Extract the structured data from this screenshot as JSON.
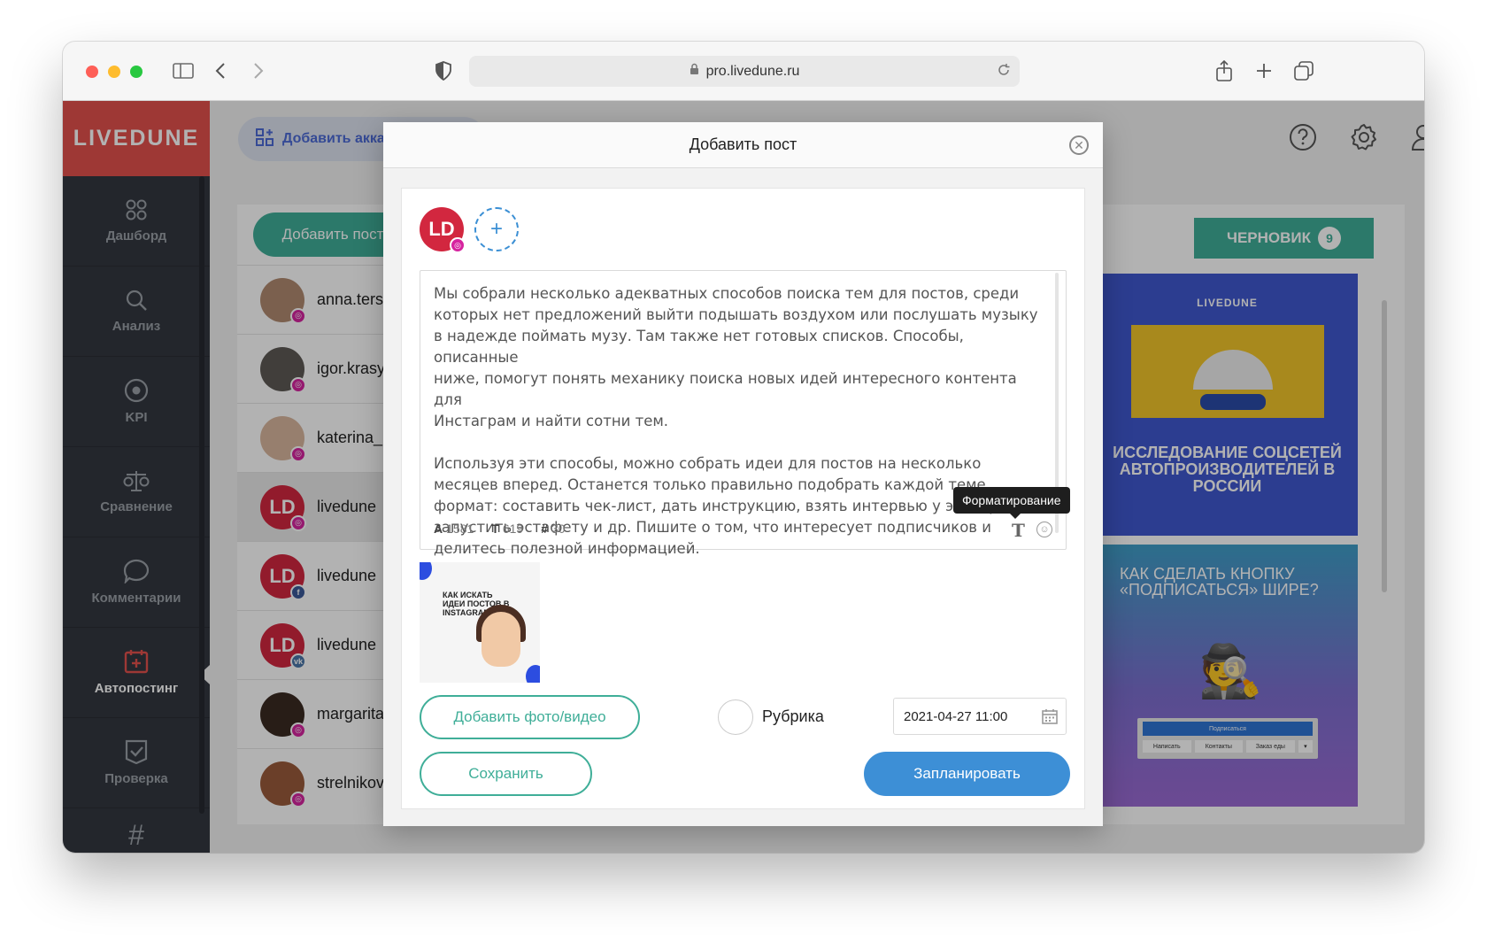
{
  "browser": {
    "url": "pro.livedune.ru"
  },
  "app": {
    "logo": "LIVEDUNE",
    "add_account_label": "Добавить акка"
  },
  "sidebar": {
    "items": [
      {
        "label": "Дашборд",
        "icon": "dashboard-icon"
      },
      {
        "label": "Анализ",
        "icon": "search-icon"
      },
      {
        "label": "KPI",
        "icon": "target-icon"
      },
      {
        "label": "Сравнение",
        "icon": "scales-icon"
      },
      {
        "label": "Комментарии",
        "icon": "comment-icon"
      },
      {
        "label": "Автопостинг",
        "icon": "calendar-plus-icon",
        "active": true
      },
      {
        "label": "Проверка",
        "icon": "check-shield-icon"
      },
      {
        "label": "#",
        "icon": "hashtag-icon"
      }
    ]
  },
  "left_panel": {
    "add_post_label": "Добавить пост",
    "accounts": [
      {
        "name": "anna.ters",
        "network": "instagram"
      },
      {
        "name": "igor.krasy",
        "network": "instagram"
      },
      {
        "name": "katerina_",
        "network": "instagram"
      },
      {
        "name": "livedune",
        "network": "instagram",
        "initials": "LD"
      },
      {
        "name": "livedune",
        "network": "facebook",
        "initials": "LD"
      },
      {
        "name": "livedune",
        "network": "vk",
        "initials": "LD"
      },
      {
        "name": "margarita",
        "network": "instagram"
      },
      {
        "name": "strelnikov",
        "network": "instagram"
      }
    ]
  },
  "right_panel": {
    "draft_label": "ЧЕРНОВИК",
    "draft_count": "9",
    "card1": {
      "brand": "LIVEDUNE",
      "headline": "ИССЛЕДОВАНИЕ СОЦСЕТЕЙ АВТОПРОИЗВОДИТЕЛЕЙ В РОССИИ"
    },
    "card2": {
      "headline": "КАК СДЕЛАТЬ КНОПКУ «ПОДПИСАТЬСЯ» ШИРЕ?",
      "mock_button": "Подписаться",
      "mock_tabs": [
        "Написать",
        "Контакты",
        "Заказ еды",
        "▾"
      ]
    }
  },
  "modal": {
    "title": "Добавить пост",
    "avatar_initials": "LD",
    "post_text": "Мы собрали несколько адекватных способов поиска тем для постов, среди\nкоторых нет предложений выйти подышать воздухом или послушать музыку\nв надежде поймать музу. Там также нет готовых списков. Способы, описанные\nниже, помогут понять механику поиска новых идей интересного контента для\nИнстаграм и найти сотни тем.\n\nИспользуя эти способы, можно собрать идеи для постов на несколько\nмесяцев вперед. Останется только правильно подобрать каждой теме\nформат: составить чек-лист, дать инструкцию, взять интервью у эксперта,\nзапустить эстафету и др. Пишите о том, что интересует подписчиков и\nделитесь полезной информацией.",
    "counters": {
      "chars_label": "A",
      "chars": "1581",
      "words_label": "T",
      "words": "619",
      "hashtags_label": "#",
      "hashtags": "30"
    },
    "tooltip": "Форматирование",
    "thumbnail_text": "КАК ИСКАТЬ ИДЕИ ПОСТОВ В INSTAGRAM",
    "add_media_label": "Добавить фото/видео",
    "rubric_label": "Рубрика",
    "date_value": "2021-04-27 11:00",
    "save_label": "Сохранить",
    "schedule_label": "Запланировать"
  },
  "colors": {
    "brand_red": "#e2514d",
    "teal": "#3fae98",
    "blue": "#3d8fd6",
    "sidebar": "#333740"
  }
}
